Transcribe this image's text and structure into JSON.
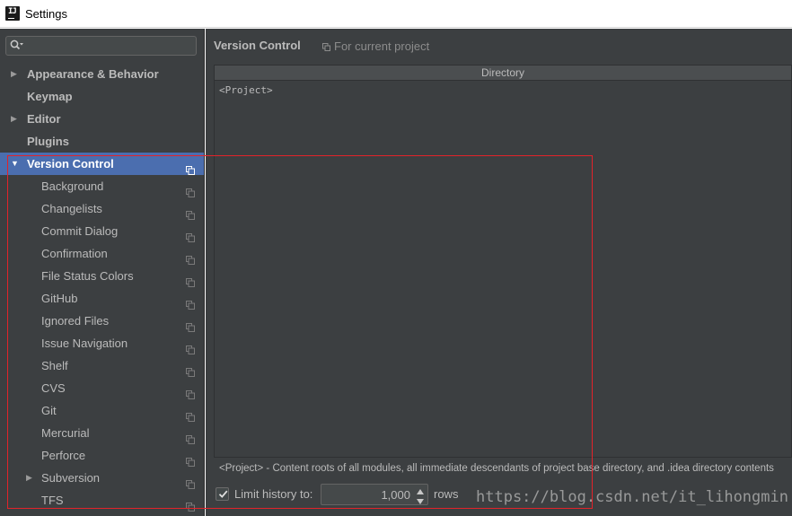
{
  "window": {
    "title": "Settings",
    "app_icon_text": "IJ"
  },
  "colors": {
    "panel_bg": "#3c3f41",
    "selection": "#4b6eaf",
    "text": "#bbbbbb",
    "highlight_box": "#e2232a"
  },
  "sidebar": {
    "search": {
      "value": "",
      "placeholder": ""
    },
    "items": [
      {
        "label": "Appearance & Behavior",
        "level": 0,
        "arrow": "▶",
        "selected": false,
        "icon": ""
      },
      {
        "label": "Keymap",
        "level": 0,
        "arrow": "",
        "selected": false,
        "icon": ""
      },
      {
        "label": "Editor",
        "level": 0,
        "arrow": "▶",
        "selected": false,
        "icon": ""
      },
      {
        "label": "Plugins",
        "level": 0,
        "arrow": "",
        "selected": false,
        "icon": ""
      },
      {
        "label": "Version Control",
        "level": 0,
        "arrow": "▼",
        "selected": true,
        "icon": "copy-icon"
      },
      {
        "label": "Background",
        "level": 1,
        "arrow": "",
        "selected": false,
        "icon": "copy-icon"
      },
      {
        "label": "Changelists",
        "level": 1,
        "arrow": "",
        "selected": false,
        "icon": "copy-icon"
      },
      {
        "label": "Commit Dialog",
        "level": 1,
        "arrow": "",
        "selected": false,
        "icon": "copy-icon"
      },
      {
        "label": "Confirmation",
        "level": 1,
        "arrow": "",
        "selected": false,
        "icon": "copy-icon"
      },
      {
        "label": "File Status Colors",
        "level": 1,
        "arrow": "",
        "selected": false,
        "icon": "copy-icon"
      },
      {
        "label": "GitHub",
        "level": 1,
        "arrow": "",
        "selected": false,
        "icon": "copy-icon"
      },
      {
        "label": "Ignored Files",
        "level": 1,
        "arrow": "",
        "selected": false,
        "icon": "copy-icon"
      },
      {
        "label": "Issue Navigation",
        "level": 1,
        "arrow": "",
        "selected": false,
        "icon": "copy-icon"
      },
      {
        "label": "Shelf",
        "level": 1,
        "arrow": "",
        "selected": false,
        "icon": "copy-icon"
      },
      {
        "label": "CVS",
        "level": 1,
        "arrow": "",
        "selected": false,
        "icon": "copy-icon"
      },
      {
        "label": "Git",
        "level": 1,
        "arrow": "",
        "selected": false,
        "icon": "copy-icon"
      },
      {
        "label": "Mercurial",
        "level": 1,
        "arrow": "",
        "selected": false,
        "icon": "copy-icon"
      },
      {
        "label": "Perforce",
        "level": 1,
        "arrow": "",
        "selected": false,
        "icon": "copy-icon"
      },
      {
        "label": "Subversion",
        "level": 1,
        "arrow": "▶",
        "selected": false,
        "icon": "copy-icon"
      },
      {
        "label": "TFS",
        "level": 1,
        "arrow": "",
        "selected": false,
        "icon": "copy-icon"
      }
    ]
  },
  "main": {
    "title": "Version Control",
    "scope_label": "For current project",
    "table": {
      "column_header": "Directory",
      "rows": [
        "<Project>"
      ]
    },
    "footer_note": "<Project> - Content roots of all modules, all immediate descendants of project base directory, and .idea directory contents",
    "limit_history": {
      "checked": true,
      "label": "Limit history to:",
      "value": "1,000",
      "unit": "rows"
    }
  },
  "watermark": "https://blog.csdn.net/it_lihongmin"
}
